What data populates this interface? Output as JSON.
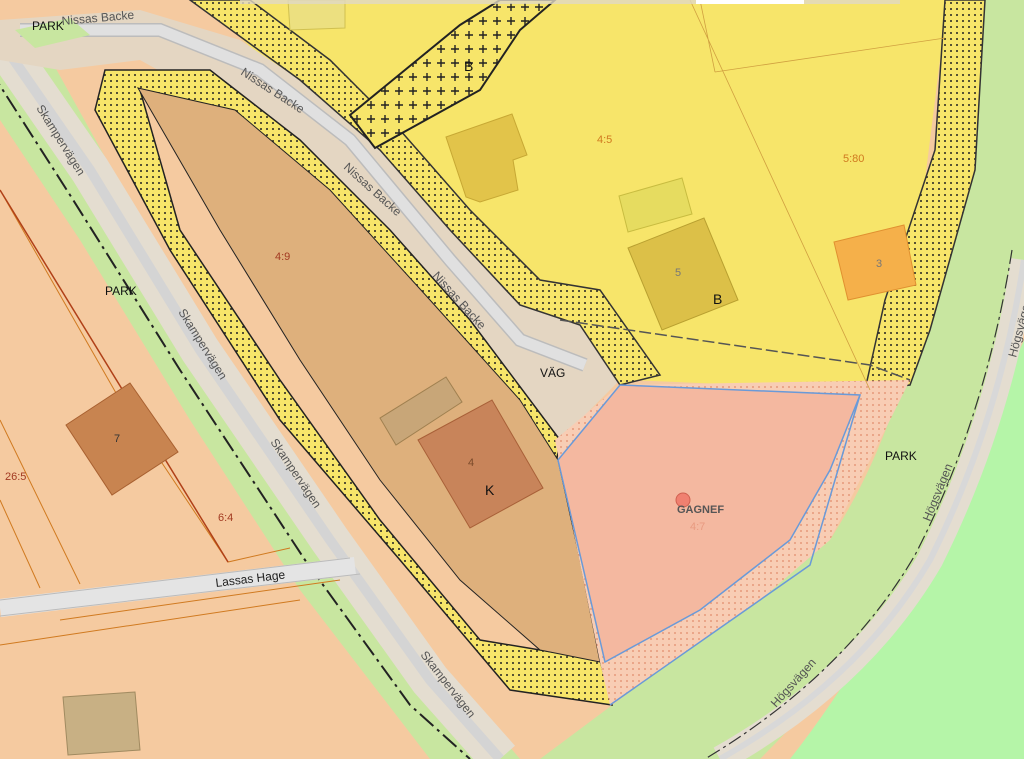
{
  "map": {
    "zone_labels": {
      "park_top_left": "PARK",
      "park_left": "PARK",
      "park_right": "PARK",
      "b_top": "B",
      "b_main": "B",
      "k_zone": "K",
      "vag": "VÄG"
    },
    "streets": {
      "nissas_1": "Nissas Backe",
      "nissas_2": "Nissas Backe",
      "nissas_3": "Nissas Backe",
      "nissas_4": "Nissas Backe",
      "skamp_1": "Skampervägen",
      "skamp_2": "Skampervägen",
      "skamp_3": "Skampervägen",
      "skamp_4": "Skampervägen",
      "lassas": "Lassas Hage",
      "hogs_1": "Högsvägen",
      "hogs_2": "Högsvägen",
      "hogs_3": "Högsvägen"
    },
    "parcels": {
      "p45": "4:5",
      "p580": "5:80",
      "p49": "4:9",
      "p265": "26:5",
      "p64": "6:4",
      "p47": "4:7"
    },
    "building_numbers": {
      "b5": "5",
      "b3": "3",
      "b7": "7",
      "b4": "4"
    },
    "place": "GAGNEF",
    "colors": {
      "residential_yellow": "#f7e56a",
      "park_green": "#c8e6a0",
      "commercial_brown": "#deb07c",
      "public_pink": "#f4b8a0",
      "road_gray": "#e6e6e6",
      "parcel_line": "#d07a20",
      "boundary_blue": "#6a9ad8"
    }
  }
}
